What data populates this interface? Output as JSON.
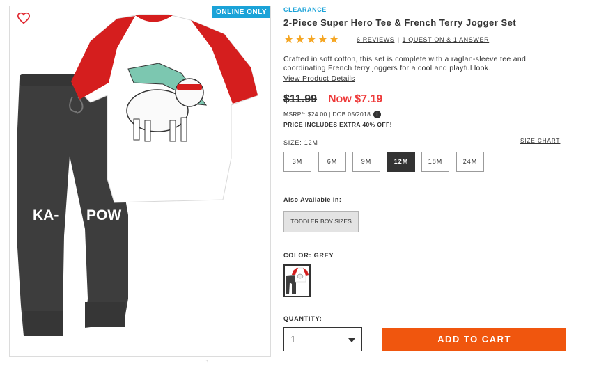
{
  "badge": {
    "online_only": "ONLINE ONLY"
  },
  "product": {
    "category": "CLEARANCE",
    "title": "2-Piece Super Hero Tee & French Terry Jogger Set",
    "rating": 5,
    "stars": "★★★★★",
    "reviews_link": "6 REVIEWS",
    "qa_link": "1 QUESTION & 1 ANSWER",
    "description": "Crafted in soft cotton, this set is complete with a raglan-sleeve tee and coordinating French terry joggers for a cool and playful look.",
    "details_link": "View Product Details",
    "jogger_text_left": "KA-",
    "jogger_text_right": "POW"
  },
  "price": {
    "original": "$11.99",
    "now": "Now $7.19",
    "msrp": "MSRP*: $24.00 | DOB 05/2018",
    "extra": "PRICE INCLUDES EXTRA 40% OFF!"
  },
  "size": {
    "label": "SIZE: 12M",
    "chart_link": "SIZE CHART",
    "options": [
      "3M",
      "6M",
      "9M",
      "12M",
      "18M",
      "24M"
    ],
    "selected": "12M"
  },
  "also": {
    "label": "Also Available In:",
    "button": "TODDLER BOY SIZES"
  },
  "color": {
    "label": "COLOR: GREY"
  },
  "quantity": {
    "label": "QUANTITY:",
    "value": "1"
  },
  "cart": {
    "button": "ADD TO CART"
  },
  "colors": {
    "accent_blue": "#1ba3d8",
    "sale_red": "#ee3a3a",
    "cta_orange": "#f0560e",
    "star_gold": "#f5a623",
    "wishlist_red": "#e0262e"
  }
}
